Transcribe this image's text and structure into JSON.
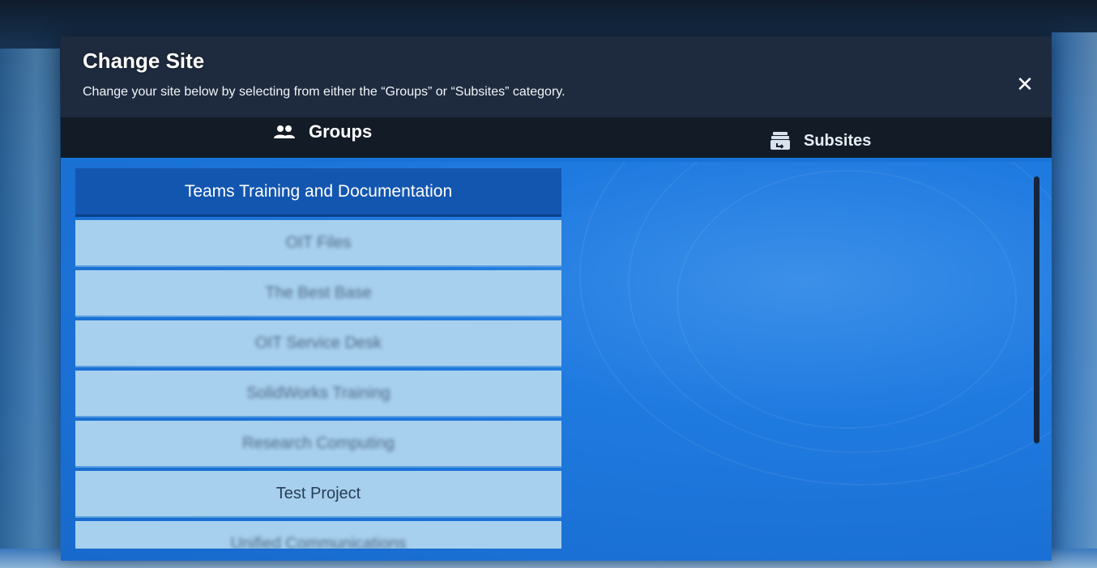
{
  "modal": {
    "title": "Change Site",
    "subtitle": "Change your site below by selecting from either the “Groups” or “Subsites” category.",
    "close_symbol": "✕"
  },
  "tabs": [
    {
      "label": "Groups",
      "icon": "people-icon"
    },
    {
      "label": "Subsites",
      "icon": "subsites-icon"
    }
  ],
  "groups": {
    "header": "Teams Training and Documentation",
    "items": [
      {
        "label": "OIT Files",
        "blurred": true
      },
      {
        "label": "The Best Base",
        "blurred": true
      },
      {
        "label": "OIT Service Desk",
        "blurred": true
      },
      {
        "label": "SolidWorks Training",
        "blurred": true
      },
      {
        "label": "Research Computing",
        "blurred": true
      },
      {
        "label": "Test Project",
        "blurred": false
      },
      {
        "label": "Unified Communications",
        "blurred": true
      }
    ]
  },
  "colors": {
    "header_bg": "#1e2b3f",
    "tabs_bg": "#131b27",
    "content_bg": "#1873d6",
    "group_header_bg": "#1356b0",
    "group_item_bg": "#a7d0ee"
  }
}
